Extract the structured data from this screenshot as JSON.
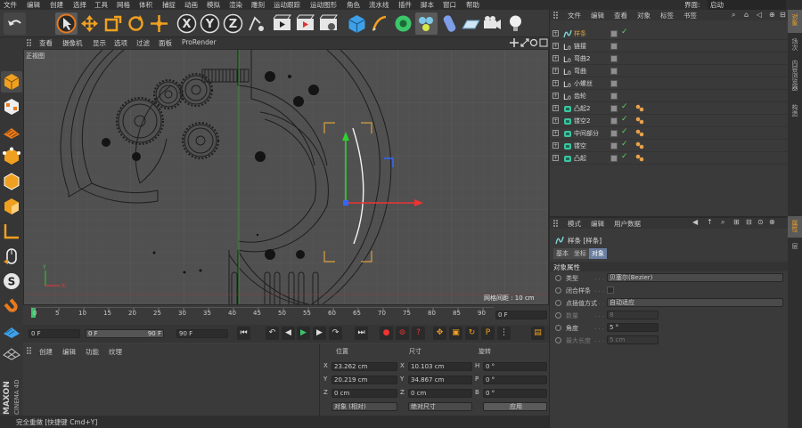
{
  "menubar": {
    "items": [
      "文件",
      "编辑",
      "创建",
      "选择",
      "工具",
      "网格",
      "体积",
      "捕捉",
      "动画",
      "模拟",
      "渲染",
      "雕刻",
      "运动跟踪",
      "运动图形",
      "角色",
      "流水线",
      "插件",
      "脚本",
      "窗口",
      "帮助"
    ],
    "layout_label": "界面:",
    "layout_value": "启动"
  },
  "toolbar": {
    "icons": [
      "undo-icon",
      "select-icon",
      "move-icon",
      "scale-icon",
      "rotate-icon",
      "transform-icon",
      "x-axis-icon",
      "y-axis-icon",
      "z-axis-icon",
      "coordinate-icon",
      "render-view-icon",
      "render-picture-icon",
      "render-settings-icon",
      "cube-icon",
      "pen-icon",
      "subdivision-icon",
      "array-icon",
      "deformer-icon",
      "floor-icon",
      "camera-icon",
      "light-icon"
    ],
    "axis": [
      "X",
      "Y",
      "Z"
    ]
  },
  "viewport": {
    "menu": [
      "查看",
      "摄像机",
      "显示",
      "选项",
      "过滤",
      "面板",
      "ProRender"
    ],
    "name": "正视图",
    "grid_info": "网格间距 : 10 cm"
  },
  "timeline": {
    "ticks": [
      "0",
      "5",
      "10",
      "15",
      "20",
      "25",
      "30",
      "35",
      "40",
      "45",
      "50",
      "55",
      "60",
      "65",
      "70",
      "75",
      "80",
      "85",
      "90"
    ],
    "frame_field": "0 F"
  },
  "transport": {
    "start": "0 F",
    "range_start": "0 F",
    "range_end": "90 F",
    "end": "90 F"
  },
  "material": {
    "menu": [
      "创建",
      "编辑",
      "功能",
      "纹理"
    ]
  },
  "coords": {
    "headers": {
      "position": "位置",
      "size": "尺寸",
      "rotation": "旋转"
    },
    "rows": [
      {
        "axis": "X",
        "pos": "23.262 cm",
        "size": "10.103 cm",
        "rot_axis": "H",
        "rot": "0 °"
      },
      {
        "axis": "Y",
        "pos": "20.219 cm",
        "size": "34.867 cm",
        "rot_axis": "P",
        "rot": "0 °"
      },
      {
        "axis": "Z",
        "pos": "0 cm",
        "size": "0 cm",
        "rot_axis": "B",
        "rot": "0 °"
      }
    ],
    "mode": "对象 (相对)",
    "size_mode": "绝对尺寸",
    "apply": "应用"
  },
  "status": "完全重做 [快捷键 Cmd+Y]",
  "brand": {
    "maxon": "MAXON",
    "cinema": "CINEMA 4D"
  },
  "objects": {
    "menu": [
      "文件",
      "编辑",
      "查看",
      "对象",
      "标签",
      "书签"
    ],
    "items": [
      {
        "name": "样条",
        "icon": "spline-icon",
        "selected": true,
        "checked": true,
        "tag": false
      },
      {
        "name": "链接",
        "icon": "null-icon",
        "selected": false,
        "checked": false,
        "tag": false
      },
      {
        "name": "弯曲2",
        "icon": "null-icon",
        "selected": false,
        "checked": false,
        "tag": false
      },
      {
        "name": "弯曲",
        "icon": "null-icon",
        "selected": false,
        "checked": false,
        "tag": false
      },
      {
        "name": "小螺丝",
        "icon": "null-icon",
        "selected": false,
        "checked": false,
        "tag": false
      },
      {
        "name": "齿轮",
        "icon": "null-icon",
        "selected": false,
        "checked": false,
        "tag": false
      },
      {
        "name": "凸起2",
        "icon": "extrude-icon",
        "selected": false,
        "checked": true,
        "tag": true
      },
      {
        "name": "镂空2",
        "icon": "extrude-icon",
        "selected": false,
        "checked": true,
        "tag": true
      },
      {
        "name": "中间部分",
        "icon": "extrude-icon",
        "selected": false,
        "checked": true,
        "tag": true
      },
      {
        "name": "镂空",
        "icon": "extrude-icon",
        "selected": false,
        "checked": true,
        "tag": true
      },
      {
        "name": "凸起",
        "icon": "extrude-icon",
        "selected": false,
        "checked": true,
        "tag": true
      }
    ]
  },
  "attributes": {
    "menu": [
      "模式",
      "编辑",
      "用户数据"
    ],
    "title": "样条 [样条]",
    "tabs": [
      "基本",
      "坐标",
      "对象"
    ],
    "section": "对象属性",
    "props": [
      {
        "label": "类型",
        "value": "贝塞尔(Bezier)",
        "kind": "select"
      },
      {
        "label": "闭合样条",
        "value": "",
        "kind": "checkbox"
      },
      {
        "label": "点插值方式",
        "value": "自动适应",
        "kind": "select"
      },
      {
        "label": "数量",
        "value": "8",
        "kind": "disabled"
      },
      {
        "label": "角度",
        "value": "5 °",
        "kind": "field"
      },
      {
        "label": "最大长度",
        "value": "5 cm",
        "kind": "disabled"
      }
    ]
  },
  "right_strip": [
    "对象",
    "场次",
    "内容浏览器",
    "构造"
  ],
  "right_strip_lower": [
    "属性",
    "层"
  ],
  "colors": {
    "accent": "#e8a24a",
    "axis_x": "#e33",
    "axis_y": "#3c3",
    "axis_z": "#36f",
    "selection": "#d9a13b"
  }
}
